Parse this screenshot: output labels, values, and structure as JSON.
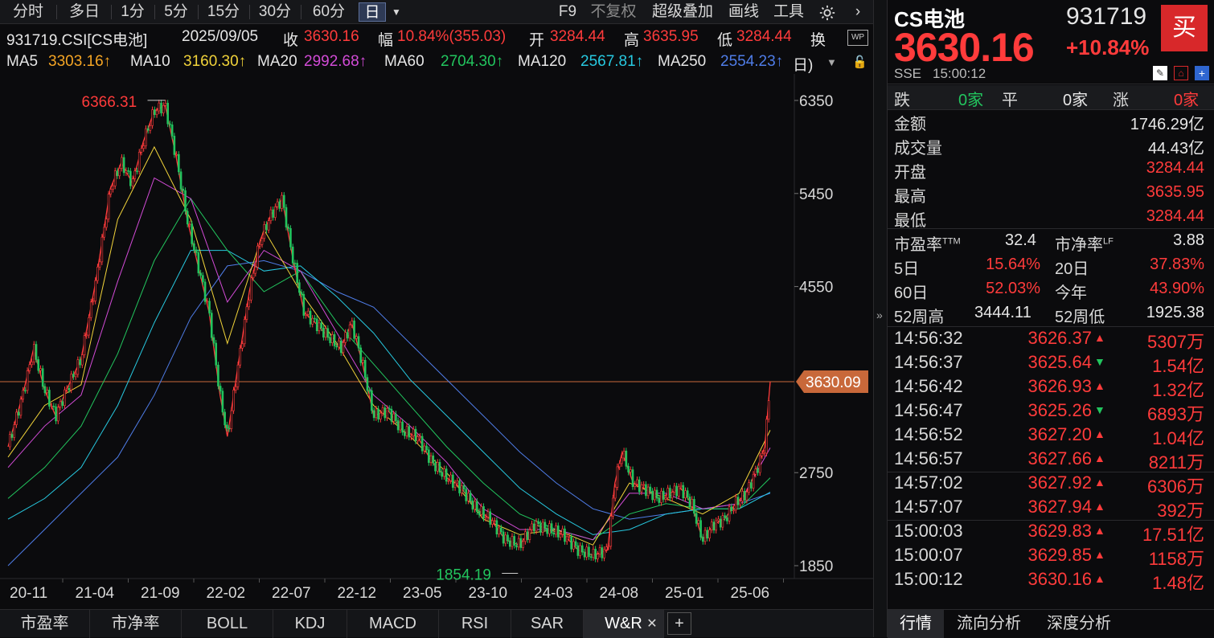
{
  "toolbar": {
    "periods": [
      "分时",
      "多日",
      "1分",
      "5分",
      "15分",
      "30分",
      "60分",
      "日"
    ],
    "active_period": "日",
    "right_items": [
      "F9",
      "不复权",
      "超级叠加",
      "画线",
      "工具"
    ]
  },
  "info": {
    "code": "931719.CSI[CS电池]",
    "date": "2025/09/05",
    "close_label": "收",
    "close": "3630.16",
    "change_label": "幅",
    "change": "10.84%(355.03)",
    "open_label": "开",
    "open": "3284.44",
    "high_label": "高",
    "high": "3635.95",
    "low_label": "低",
    "low": "3284.44",
    "turnover_label": "换"
  },
  "ma": [
    {
      "label": "MA5",
      "value": "3303.16↑",
      "color": "#f5a524"
    },
    {
      "label": "MA10",
      "value": "3160.30↑",
      "color": "#f1d33a"
    },
    {
      "label": "MA20",
      "value": "2992.68↑",
      "color": "#d24bd6"
    },
    {
      "label": "MA60",
      "value": "2704.30↑",
      "color": "#22c55e"
    },
    {
      "label": "MA120",
      "value": "2567.81↑",
      "color": "#27c9e0"
    },
    {
      "label": "MA250",
      "value": "2554.23↑",
      "color": "#4f7de8"
    }
  ],
  "ma_tail": "日)",
  "chart_data": {
    "type": "line",
    "x_ticks": [
      "20-11",
      "21-04",
      "21-09",
      "22-02",
      "22-07",
      "22-12",
      "23-05",
      "23-10",
      "24-03",
      "24-08",
      "25-01",
      "25-06"
    ],
    "y_ticks": [
      6350,
      5450,
      4550,
      2750,
      1850
    ],
    "ylim": [
      1850,
      6350
    ],
    "price_line": 3630.09,
    "price_label": "3630.09",
    "max_label": "6366.31",
    "min_label": "1854.19",
    "series": [
      {
        "name": "",
        "points": [
          [
            0,
            3000
          ],
          [
            0.4,
            3500
          ],
          [
            0.7,
            3950
          ],
          [
            1,
            3550
          ],
          [
            1.3,
            3300
          ],
          [
            1.6,
            3550
          ],
          [
            2,
            3850
          ],
          [
            2.4,
            4600
          ],
          [
            2.8,
            5500
          ],
          [
            3.1,
            5750
          ],
          [
            3.4,
            5550
          ],
          [
            3.7,
            5950
          ],
          [
            4,
            6250
          ],
          [
            4.3,
            6300
          ],
          [
            4.6,
            5800
          ],
          [
            4.9,
            5200
          ],
          [
            5.2,
            4750
          ],
          [
            5.5,
            4300
          ],
          [
            5.8,
            3500
          ],
          [
            6,
            3100
          ],
          [
            6.3,
            3800
          ],
          [
            6.6,
            4500
          ],
          [
            6.9,
            5000
          ],
          [
            7.2,
            5250
          ],
          [
            7.5,
            5400
          ],
          [
            7.8,
            4800
          ],
          [
            8.1,
            4300
          ],
          [
            8.4,
            4200
          ],
          [
            8.8,
            4050
          ],
          [
            9.1,
            3950
          ],
          [
            9.4,
            4200
          ],
          [
            9.7,
            3800
          ],
          [
            10,
            3300
          ],
          [
            10.4,
            3350
          ],
          [
            10.8,
            3150
          ],
          [
            11.2,
            3100
          ],
          [
            11.6,
            2850
          ],
          [
            12,
            2700
          ],
          [
            12.4,
            2600
          ],
          [
            12.8,
            2400
          ],
          [
            13.2,
            2300
          ],
          [
            13.6,
            2100
          ],
          [
            14,
            2050
          ],
          [
            14.4,
            2250
          ],
          [
            14.8,
            2200
          ],
          [
            15.2,
            2150
          ],
          [
            15.6,
            2000
          ],
          [
            16,
            1950
          ],
          [
            16.4,
            2000
          ],
          [
            16.6,
            2650
          ],
          [
            16.8,
            2950
          ],
          [
            17.1,
            2650
          ],
          [
            17.4,
            2600
          ],
          [
            17.8,
            2500
          ],
          [
            18.1,
            2550
          ],
          [
            18.4,
            2600
          ],
          [
            18.7,
            2450
          ],
          [
            19,
            2100
          ],
          [
            19.3,
            2250
          ],
          [
            19.6,
            2300
          ],
          [
            19.9,
            2450
          ],
          [
            20.2,
            2550
          ],
          [
            20.5,
            2800
          ],
          [
            20.7,
            3000
          ],
          [
            20.85,
            3630
          ]
        ]
      },
      {
        "name": "",
        "points": [
          [
            0,
            2900
          ],
          [
            1,
            3400
          ],
          [
            2,
            3600
          ],
          [
            3,
            5200
          ],
          [
            4,
            5900
          ],
          [
            5,
            5200
          ],
          [
            6,
            4000
          ],
          [
            7,
            5100
          ],
          [
            8,
            4500
          ],
          [
            9,
            4000
          ],
          [
            10,
            3400
          ],
          [
            11,
            3100
          ],
          [
            12,
            2750
          ],
          [
            13,
            2300
          ],
          [
            14,
            2150
          ],
          [
            15,
            2200
          ],
          [
            16,
            2050
          ],
          [
            17,
            2650
          ],
          [
            18,
            2500
          ],
          [
            19,
            2350
          ],
          [
            20,
            2550
          ],
          [
            20.85,
            3160
          ]
        ]
      },
      {
        "name": "",
        "points": [
          [
            0,
            2800
          ],
          [
            1,
            3200
          ],
          [
            2,
            3500
          ],
          [
            3,
            4600
          ],
          [
            4,
            5600
          ],
          [
            5,
            5400
          ],
          [
            6,
            4400
          ],
          [
            7,
            4900
          ],
          [
            8,
            4700
          ],
          [
            9,
            4100
          ],
          [
            10,
            3500
          ],
          [
            11,
            3200
          ],
          [
            12,
            2850
          ],
          [
            13,
            2400
          ],
          [
            14,
            2200
          ],
          [
            15,
            2200
          ],
          [
            16,
            2100
          ],
          [
            17,
            2550
          ],
          [
            18,
            2550
          ],
          [
            19,
            2400
          ],
          [
            20,
            2450
          ],
          [
            20.85,
            2990
          ]
        ]
      },
      {
        "name": "",
        "points": [
          [
            0,
            2500
          ],
          [
            1,
            2800
          ],
          [
            2,
            3200
          ],
          [
            3,
            3900
          ],
          [
            4,
            4800
          ],
          [
            5,
            5400
          ],
          [
            6,
            4900
          ],
          [
            7,
            4500
          ],
          [
            8,
            4700
          ],
          [
            9,
            4200
          ],
          [
            10,
            3800
          ],
          [
            11,
            3400
          ],
          [
            12,
            3000
          ],
          [
            13,
            2650
          ],
          [
            14,
            2350
          ],
          [
            15,
            2200
          ],
          [
            16,
            2100
          ],
          [
            17,
            2350
          ],
          [
            18,
            2450
          ],
          [
            19,
            2400
          ],
          [
            20,
            2400
          ],
          [
            20.85,
            2700
          ]
        ]
      },
      {
        "name": "",
        "points": [
          [
            0,
            2300
          ],
          [
            1,
            2500
          ],
          [
            2,
            2800
          ],
          [
            3,
            3400
          ],
          [
            4,
            4200
          ],
          [
            5,
            4900
          ],
          [
            6,
            4900
          ],
          [
            7,
            4700
          ],
          [
            8,
            4750
          ],
          [
            9,
            4450
          ],
          [
            10,
            4100
          ],
          [
            11,
            3650
          ],
          [
            12,
            3300
          ],
          [
            13,
            2950
          ],
          [
            14,
            2600
          ],
          [
            15,
            2350
          ],
          [
            16,
            2150
          ],
          [
            17,
            2200
          ],
          [
            18,
            2350
          ],
          [
            19,
            2400
          ],
          [
            20,
            2400
          ],
          [
            20.85,
            2560
          ]
        ]
      },
      {
        "name": "",
        "points": [
          [
            0,
            1850
          ],
          [
            1,
            2200
          ],
          [
            2,
            2550
          ],
          [
            3,
            2900
          ],
          [
            4,
            3500
          ],
          [
            5,
            4250
          ],
          [
            6,
            4750
          ],
          [
            7,
            4800
          ],
          [
            8,
            4700
          ],
          [
            9,
            4500
          ],
          [
            10,
            4350
          ],
          [
            11,
            4000
          ],
          [
            12,
            3650
          ],
          [
            13,
            3300
          ],
          [
            14,
            2950
          ],
          [
            15,
            2650
          ],
          [
            16,
            2400
          ],
          [
            17,
            2300
          ],
          [
            18,
            2350
          ],
          [
            19,
            2400
          ],
          [
            20,
            2450
          ],
          [
            20.85,
            2550
          ]
        ]
      }
    ]
  },
  "indicator_tabs": [
    "市盈率",
    "市净率",
    "BOLL",
    "KDJ",
    "MACD",
    "RSI",
    "SAR",
    "W&R"
  ],
  "right": {
    "name": "CS电池",
    "code": "931719",
    "price": "3630.16",
    "change_pct": "+10.84%",
    "buy_label": "买",
    "exchange": "SSE",
    "time": "15:00:12",
    "breadth": {
      "down_label": "跌",
      "down": "0家",
      "flat_label": "平",
      "flat": "0家",
      "up_label": "涨",
      "up": "0家"
    },
    "stats": [
      {
        "label": "金额",
        "value": "1746.29亿",
        "color": "#e6e6e6"
      },
      {
        "label": "成交量",
        "value": "44.43亿",
        "color": "#e6e6e6"
      },
      {
        "label": "开盘",
        "value": "3284.44",
        "color": "#ff3b3b"
      },
      {
        "label": "最高",
        "value": "3635.95",
        "color": "#ff3b3b"
      },
      {
        "label": "最低",
        "value": "3284.44",
        "color": "#ff3b3b"
      }
    ],
    "pe_label": "市盈率",
    "pe_sup": "TTM",
    "pe": "32.4",
    "pb_label": "市净率",
    "pb_sup": "LF",
    "pb": "3.88",
    "returns": [
      {
        "l1": "5日",
        "v1": "15.64%",
        "l2": "20日",
        "v2": "37.83%"
      },
      {
        "l1": "60日",
        "v1": "52.03%",
        "l2": "今年",
        "v2": "43.90%"
      }
    ],
    "w52": {
      "high_label": "52周高",
      "high": "3444.11",
      "low_label": "52周低",
      "low": "1925.38"
    },
    "ticks": [
      {
        "time": "14:56:32",
        "price": "3626.37",
        "dir": "up",
        "vol": "5307万"
      },
      {
        "time": "14:56:37",
        "price": "3625.64",
        "dir": "down",
        "vol": "1.54亿"
      },
      {
        "time": "14:56:42",
        "price": "3626.93",
        "dir": "up",
        "vol": "1.32亿"
      },
      {
        "time": "14:56:47",
        "price": "3625.26",
        "dir": "down",
        "vol": "6893万"
      },
      {
        "time": "14:56:52",
        "price": "3627.20",
        "dir": "up",
        "vol": "1.04亿"
      },
      {
        "time": "14:56:57",
        "price": "3627.66",
        "dir": "up",
        "vol": "8211万"
      },
      {
        "time": "14:57:02",
        "price": "3627.92",
        "dir": "up",
        "vol": "6306万"
      },
      {
        "time": "14:57:07",
        "price": "3627.94",
        "dir": "up",
        "vol": "392万"
      },
      {
        "time": "15:00:03",
        "price": "3629.83",
        "dir": "up",
        "vol": "17.51亿"
      },
      {
        "time": "15:00:07",
        "price": "3629.85",
        "dir": "up",
        "vol": "1158万"
      },
      {
        "time": "15:00:12",
        "price": "3630.16",
        "dir": "up",
        "vol": "1.48亿"
      }
    ],
    "bottom_tabs": [
      "行情",
      "流向分析",
      "深度分析"
    ]
  },
  "colors": {
    "up": "#ff3b3b",
    "down": "#22c55e",
    "bg": "#0b0b0d",
    "grid": "#2a2a2d",
    "price_line": "#c8683a"
  }
}
